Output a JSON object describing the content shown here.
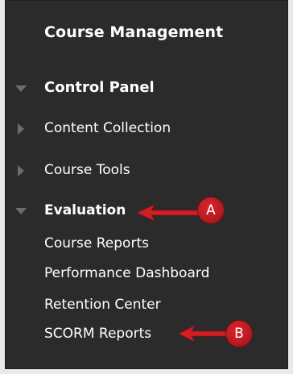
{
  "panel": {
    "title": "Course Management"
  },
  "sections": [
    {
      "label": "Control Panel",
      "expanded": true
    },
    {
      "label": "Content Collection",
      "expanded": false
    },
    {
      "label": "Course Tools",
      "expanded": false
    },
    {
      "label": "Evaluation",
      "expanded": true
    }
  ],
  "evaluation_items": [
    "Course Reports",
    "Performance Dashboard",
    "Retention Center",
    "SCORM Reports"
  ],
  "callouts": {
    "a": "A",
    "b": "B"
  },
  "colors": {
    "panel_bg": "#2b2b2b",
    "text": "#ffffff",
    "triangle": "#6d6d6d",
    "callout_red": "#c41e24"
  }
}
